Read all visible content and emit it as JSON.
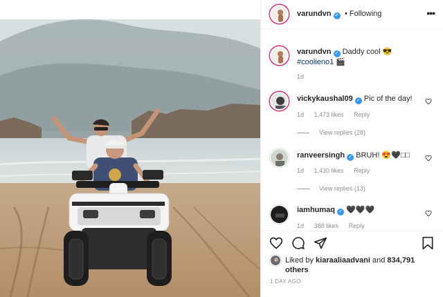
{
  "post": {
    "author": "varundvn",
    "follow_status": "• Following",
    "more_label": "•••"
  },
  "caption": {
    "username": "varundvn",
    "text": "Daddy cool 😎",
    "hashtag": "#coolieno1 🎬",
    "age": "1d"
  },
  "comments": [
    {
      "username": "vickykaushal09",
      "text": "Pic of the day!",
      "age": "1d",
      "likes": "1,473 likes",
      "reply": "Reply",
      "view_replies": "View replies (28)"
    },
    {
      "username": "ranveersingh",
      "text": "BRUH! 😍🖤□□",
      "age": "1d",
      "likes": "1,430 likes",
      "reply": "Reply",
      "view_replies": "View replies (13)"
    },
    {
      "username": "iamhumaq",
      "text": "🖤🖤🖤",
      "age": "1d",
      "likes": "388 likes",
      "reply": "Reply"
    }
  ],
  "likes": {
    "prefix": "Liked by",
    "user": "kiaraaliaadvani",
    "joiner": "and",
    "others": "834,791 others"
  },
  "date": "1 DAY AGO",
  "icons": {
    "like": "heart-icon",
    "comment": "comment-icon",
    "share": "share-icon",
    "save": "bookmark-icon",
    "verified": "verified-badge-icon",
    "more": "more-options-icon"
  },
  "colors": {
    "verified": "#3897f0",
    "story_ring": "#d62976",
    "text": "#262626",
    "muted": "#8e8e8e"
  }
}
